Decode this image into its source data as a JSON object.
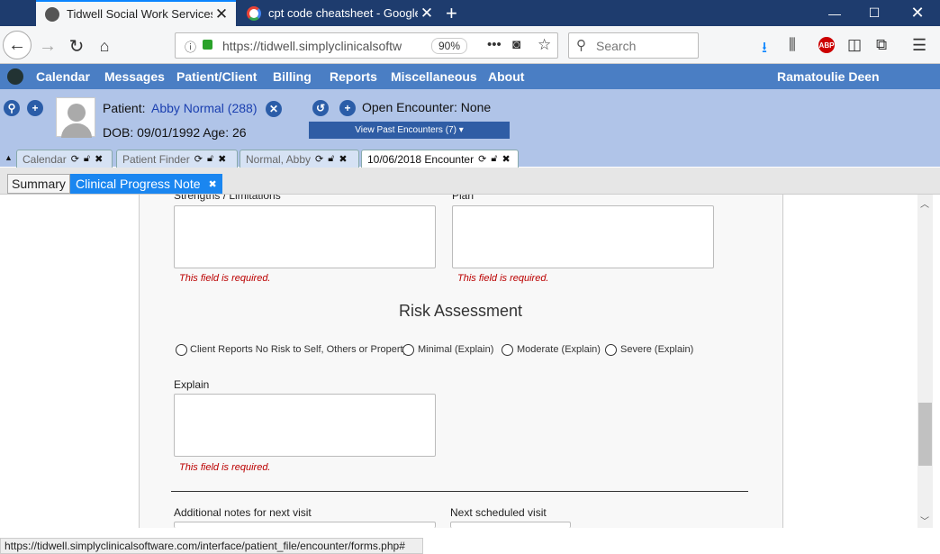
{
  "browser": {
    "tabs": [
      {
        "title": "Tidwell Social Work Services an"
      },
      {
        "title": "cpt code cheatsheet - Google S"
      }
    ],
    "url": "https://tidwell.simplyclinicalsoftw",
    "zoom": "90%",
    "search_placeholder": "Search",
    "status_url": "https://tidwell.simplyclinicalsoftware.com/interface/patient_file/encounter/forms.php#"
  },
  "app_menu": {
    "items": [
      "Calendar",
      "Messages",
      "Patient/Client",
      "Billing",
      "Reports",
      "Miscellaneous",
      "About"
    ],
    "user": "Ramatoulie Deen"
  },
  "patient": {
    "label": "Patient:",
    "name": "Abby Normal (288)",
    "dob": "DOB: 09/01/1992 Age: 26",
    "encounter": "Open Encounter: None",
    "past_encounters": "View Past Encounters  (7) ▾"
  },
  "encounter_tabs": [
    {
      "label": "Calendar"
    },
    {
      "label": "Patient Finder"
    },
    {
      "label": "Normal, Abby"
    },
    {
      "label": "10/06/2018 Encounter"
    }
  ],
  "form_tabs": {
    "summary": "Summary",
    "note": "Clinical Progress Note"
  },
  "form": {
    "strengths_label": "Strengths / Limitations",
    "plan_label": "Plan",
    "required": "This field is required.",
    "risk_title": "Risk Assessment",
    "risk_options": [
      "Client Reports No Risk to Self, Others or Property",
      "Minimal (Explain)",
      "Moderate (Explain)",
      "Severe (Explain)"
    ],
    "explain_label": "Explain",
    "additional_label": "Additional notes for next visit",
    "next_label": "Next scheduled visit"
  },
  "colors": {
    "menu": "#4a7ec4",
    "header": "#b0c4e8",
    "accent": "#1a86f0",
    "required": "#bb0000"
  }
}
